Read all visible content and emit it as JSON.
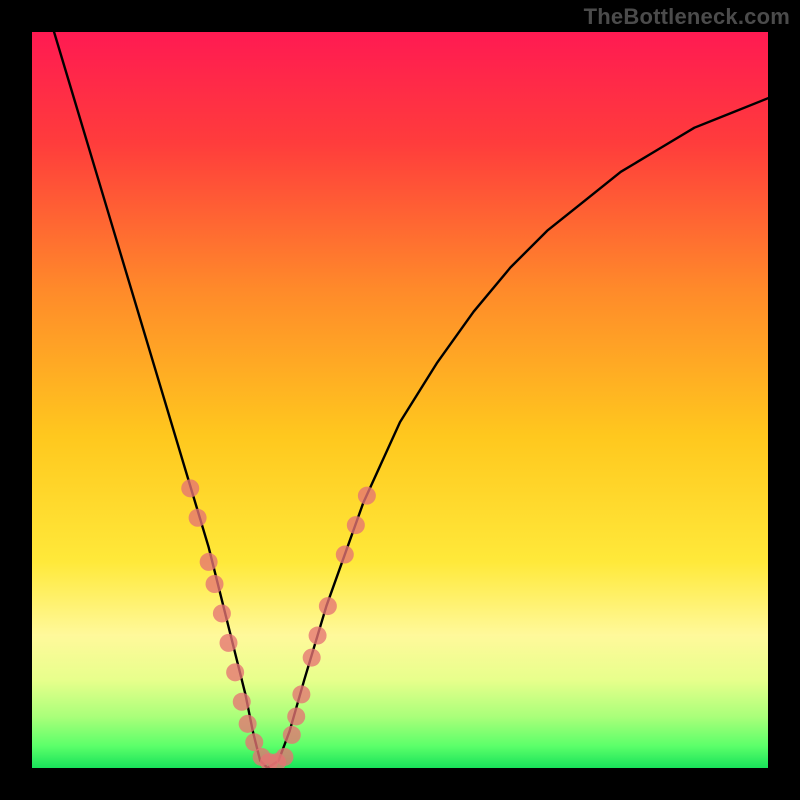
{
  "watermark": "TheBottleneck.com",
  "chart_data": {
    "type": "line",
    "title": "",
    "xlabel": "",
    "ylabel": "",
    "xlim": [
      0,
      100
    ],
    "ylim": [
      0,
      100
    ],
    "grid": false,
    "legend": false,
    "series": [
      {
        "name": "curve",
        "x": [
          3,
          6,
          9,
          12,
          15,
          18,
          21,
          24,
          26,
          27.5,
          29,
          30,
          31,
          32,
          33.5,
          35,
          37,
          40,
          45,
          50,
          55,
          60,
          65,
          70,
          75,
          80,
          85,
          90,
          95,
          100
        ],
        "y": [
          100,
          90,
          80,
          70,
          60,
          50,
          40,
          30,
          22,
          16,
          10,
          5,
          1,
          0,
          1,
          5,
          12,
          22,
          36,
          47,
          55,
          62,
          68,
          73,
          77,
          81,
          84,
          87,
          89,
          91
        ]
      }
    ],
    "markers": [
      {
        "x": 21.5,
        "y": 38
      },
      {
        "x": 22.5,
        "y": 34
      },
      {
        "x": 24.0,
        "y": 28
      },
      {
        "x": 24.8,
        "y": 25
      },
      {
        "x": 25.8,
        "y": 21
      },
      {
        "x": 26.7,
        "y": 17
      },
      {
        "x": 27.6,
        "y": 13
      },
      {
        "x": 28.5,
        "y": 9
      },
      {
        "x": 29.3,
        "y": 6
      },
      {
        "x": 30.2,
        "y": 3.5
      },
      {
        "x": 31.2,
        "y": 1.5
      },
      {
        "x": 32.2,
        "y": 0.8
      },
      {
        "x": 33.3,
        "y": 0.8
      },
      {
        "x": 34.3,
        "y": 1.5
      },
      {
        "x": 35.3,
        "y": 4.5
      },
      {
        "x": 35.9,
        "y": 7
      },
      {
        "x": 36.6,
        "y": 10
      },
      {
        "x": 38.0,
        "y": 15
      },
      {
        "x": 38.8,
        "y": 18
      },
      {
        "x": 40.2,
        "y": 22
      },
      {
        "x": 42.5,
        "y": 29
      },
      {
        "x": 44.0,
        "y": 33
      },
      {
        "x": 45.5,
        "y": 37
      }
    ],
    "gradient_stops": [
      {
        "pos": 0.0,
        "color": "#ff1a52"
      },
      {
        "pos": 0.15,
        "color": "#ff3c3c"
      },
      {
        "pos": 0.35,
        "color": "#ff8a2a"
      },
      {
        "pos": 0.55,
        "color": "#ffc81e"
      },
      {
        "pos": 0.72,
        "color": "#ffe93a"
      },
      {
        "pos": 0.82,
        "color": "#fff99b"
      },
      {
        "pos": 0.88,
        "color": "#e8ff8c"
      },
      {
        "pos": 0.93,
        "color": "#aaff7a"
      },
      {
        "pos": 0.97,
        "color": "#5cff6a"
      },
      {
        "pos": 1.0,
        "color": "#18e25a"
      }
    ],
    "marker_style": {
      "fill": "#e57373",
      "r": 9,
      "alpha": 0.78
    },
    "curve_style": {
      "stroke": "#000000",
      "width": 2.4
    }
  }
}
